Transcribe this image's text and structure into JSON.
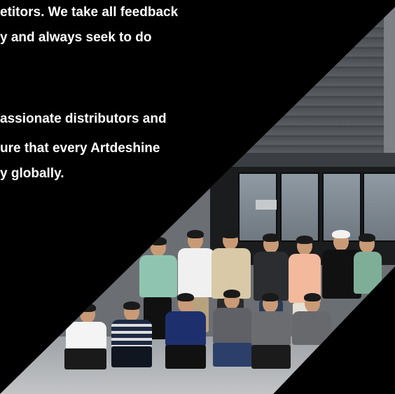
{
  "text": {
    "paragraph1": [
      "etitors. We take all feedback",
      "y and always seek to do"
    ],
    "paragraph2": [
      "assionate distributors and",
      "ure that every Artdeshine",
      "y globally."
    ]
  },
  "colors": {
    "background": "#000000",
    "text": "#ffffff"
  }
}
